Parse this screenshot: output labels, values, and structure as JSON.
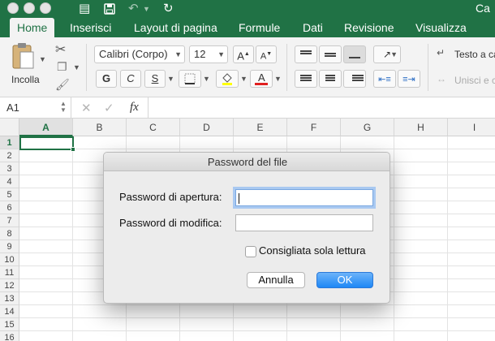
{
  "window": {
    "title": "Ca",
    "icons": [
      "sidebar-icon",
      "save-icon",
      "undo-icon",
      "redo-icon"
    ]
  },
  "tabs": [
    {
      "label": "Home",
      "active": true
    },
    {
      "label": "Inserisci"
    },
    {
      "label": "Layout di pagina"
    },
    {
      "label": "Formule"
    },
    {
      "label": "Dati"
    },
    {
      "label": "Revisione"
    },
    {
      "label": "Visualizza"
    }
  ],
  "ribbon": {
    "paste_label": "Incolla",
    "font_name": "Calibri (Corpo)",
    "font_size": "12",
    "bold": "G",
    "italic": "C",
    "underline": "S",
    "wrap_text": "Testo a ca",
    "merge": "Unisci e c"
  },
  "formula_bar": {
    "name_box": "A1"
  },
  "grid": {
    "columns": [
      "A",
      "B",
      "C",
      "D",
      "E",
      "F",
      "G",
      "H",
      "I"
    ],
    "rows": [
      "1",
      "2",
      "3",
      "4",
      "5",
      "6",
      "7",
      "8",
      "9",
      "10",
      "11",
      "12",
      "13",
      "14",
      "15",
      "16"
    ],
    "selected_cell": "A1"
  },
  "dialog": {
    "title": "Password del file",
    "open_password_label": "Password di apertura:",
    "modify_password_label": "Password di modifica:",
    "readonly_label": "Consigliata sola lettura",
    "readonly_checked": false,
    "cancel_label": "Annulla",
    "ok_label": "OK"
  },
  "colors": {
    "excel_green": "#207245",
    "ok_blue": "#1e87f5"
  }
}
